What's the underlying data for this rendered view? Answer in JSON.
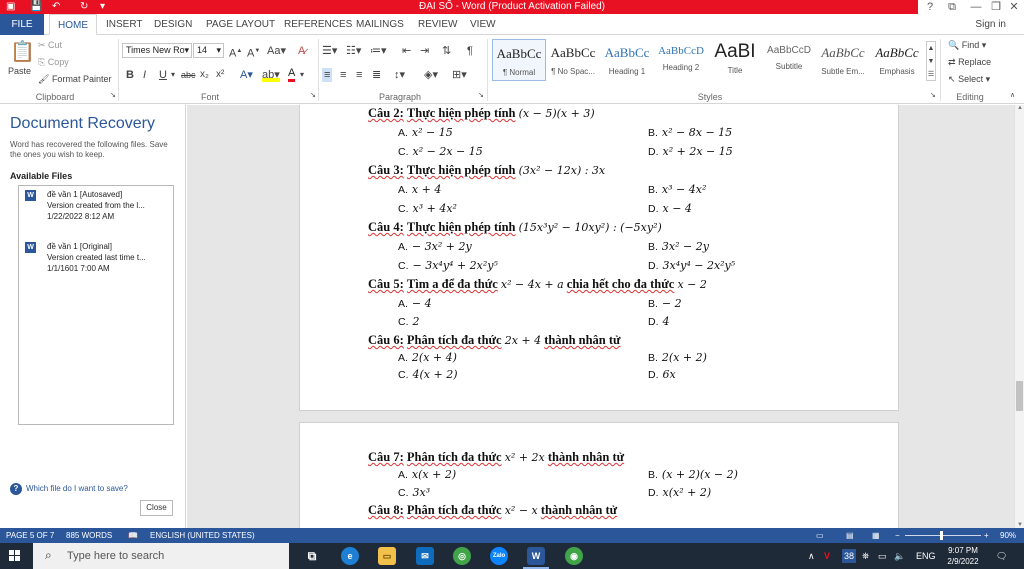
{
  "window": {
    "title": "ĐẠI SỐ - Word (Product Activation Failed)",
    "help_btn": "?",
    "restore_ribbon": "⧉",
    "minimize": "—",
    "maximize": "❐",
    "close": "✕"
  },
  "colors": {
    "accent": "#2b579a",
    "titlebar_alert": "#e81123",
    "taskbar": "#1f2a38"
  },
  "tabs": {
    "file": "FILE",
    "items": [
      "HOME",
      "INSERT",
      "DESIGN",
      "PAGE LAYOUT",
      "REFERENCES",
      "MAILINGS",
      "REVIEW",
      "VIEW"
    ],
    "active": "HOME",
    "sign_in": "Sign in"
  },
  "ribbon": {
    "clipboard": {
      "label": "Clipboard",
      "paste": "Paste",
      "cut": "Cut",
      "copy": "Copy",
      "format_painter": "Format Painter"
    },
    "font": {
      "label": "Font",
      "family": "Times New Ro",
      "size": "14"
    },
    "paragraph": {
      "label": "Paragraph"
    },
    "styles": {
      "label": "Styles",
      "items": [
        {
          "preview": "AaBbCc",
          "name": "¶ Normal"
        },
        {
          "preview": "AaBbCc",
          "name": "¶ No Spac..."
        },
        {
          "preview": "AaBbCc",
          "name": "Heading 1"
        },
        {
          "preview": "AaBbCcD",
          "name": "Heading 2"
        },
        {
          "preview": "AaBI",
          "name": "Title"
        },
        {
          "preview": "AaBbCcD",
          "name": "Subtitle"
        },
        {
          "preview": "AaBbCc",
          "name": "Subtle Em..."
        },
        {
          "preview": "AaBbCc",
          "name": "Emphasis"
        }
      ]
    },
    "editing": {
      "label": "Editing",
      "find": "Find",
      "replace": "Replace",
      "select": "Select"
    }
  },
  "recovery": {
    "title": "Document Recovery",
    "description": "Word has recovered the following files. Save the ones you wish to keep.",
    "available": "Available Files",
    "files": [
      {
        "name": "đề vần 1  [Autosaved]",
        "info": "Version created from the l...",
        "date": "1/22/2022 8:12 AM"
      },
      {
        "name": "đề vần 1  [Original]",
        "info": "Version created last time t...",
        "date": "1/1/1601 7:00 AM"
      }
    ],
    "help_link": "Which file do I want to save?",
    "close_button": "Close"
  },
  "document": {
    "questions": [
      {
        "id": "q2",
        "label": "Câu 2:",
        "text": "Thực hiện phép tính",
        "expr": "(x − 5)(x + 3)",
        "answers": [
          {
            "k": "A.",
            "v": "x² − 15"
          },
          {
            "k": "B.",
            "v": "x² − 8x − 15"
          },
          {
            "k": "C.",
            "v": "x² − 2x − 15"
          },
          {
            "k": "D.",
            "v": "x² + 2x − 15"
          }
        ]
      },
      {
        "id": "q3",
        "label": "Câu 3:",
        "text": "Thực hiện phép tính",
        "expr": "(3x² − 12x) : 3x",
        "answers": [
          {
            "k": "A.",
            "v": "x + 4"
          },
          {
            "k": "B.",
            "v": "x³ − 4x²"
          },
          {
            "k": "C.",
            "v": "x³ + 4x²"
          },
          {
            "k": "D.",
            "v": "x − 4"
          }
        ]
      },
      {
        "id": "q4",
        "label": "Câu 4:",
        "text": "Thực hiện phép tính",
        "expr": "(15x³y² − 10xy²) : (−5xy²)",
        "answers": [
          {
            "k": "A.",
            "v": "− 3x² + 2y"
          },
          {
            "k": "B.",
            "v": "3x² − 2y"
          },
          {
            "k": "C.",
            "v": "− 3x⁴y⁴ + 2x²y⁵"
          },
          {
            "k": "D.",
            "v": "3x⁴y⁴ − 2x²y⁵"
          }
        ]
      },
      {
        "id": "q5",
        "label": "Câu 5:",
        "text": "Tìm a để đa thức",
        "expr": "x² − 4x + a",
        "text2": "chia hết cho đa thức",
        "expr2": "x − 2",
        "answers": [
          {
            "k": "A.",
            "v": "− 4"
          },
          {
            "k": "B.",
            "v": "− 2"
          },
          {
            "k": "C.",
            "v": "2"
          },
          {
            "k": "D.",
            "v": "4"
          }
        ]
      },
      {
        "id": "q6",
        "label": "Câu 6:",
        "text": "Phân tích đa thức",
        "expr": "2x + 4",
        "text2": "thành nhân tử",
        "answers": [
          {
            "k": "A.",
            "v": "2(x + 4)"
          },
          {
            "k": "B.",
            "v": "2(x + 2)"
          },
          {
            "k": "C.",
            "v": "4(x + 2)"
          },
          {
            "k": "D.",
            "v": "6x"
          }
        ]
      },
      {
        "id": "q7",
        "label": "Câu 7:",
        "text": "Phân tích đa thức",
        "expr": "x² + 2x",
        "text2": "thành nhân tử",
        "answers": [
          {
            "k": "A.",
            "v": "x(x + 2)"
          },
          {
            "k": "B.",
            "v": "(x + 2)(x − 2)"
          },
          {
            "k": "C.",
            "v": "3x³"
          },
          {
            "k": "D.",
            "v": "x(x² + 2)"
          }
        ]
      },
      {
        "id": "q8",
        "label": "Câu 8:",
        "text": "Phân tích đa thức",
        "expr": "x² − x",
        "text2": "thành nhân tử"
      }
    ]
  },
  "statusbar": {
    "page": "PAGE 5 OF 7",
    "words": "885 WORDS",
    "language": "ENGLISH (UNITED STATES)",
    "zoom": "90%"
  },
  "taskbar": {
    "search_placeholder": "Type here to search",
    "language": "ENG",
    "time": "9:07 PM",
    "date": "2/9/2022"
  }
}
